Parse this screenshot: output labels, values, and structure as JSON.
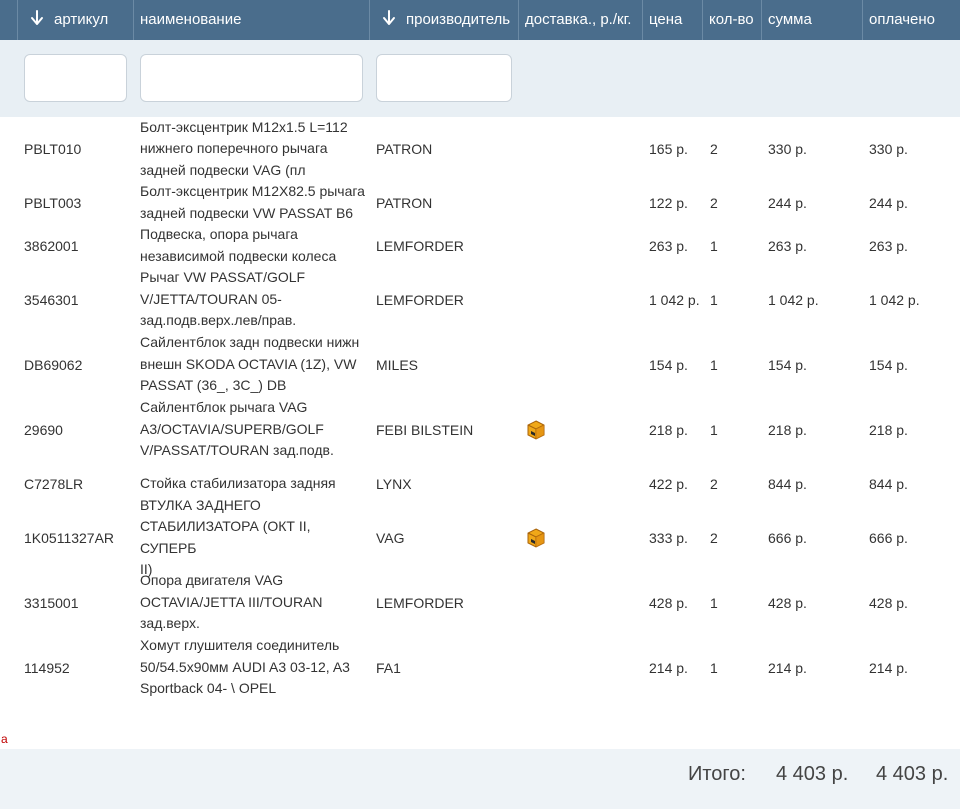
{
  "table": {
    "columns": {
      "article": "артикул",
      "name": "наименование",
      "maker": "производитель",
      "delivery": "доставка., р./кг.",
      "price": "цена",
      "qty": "кол-во",
      "sum": "сумма",
      "paid": "оплачено"
    },
    "filters": {
      "article": "",
      "name": "",
      "maker": ""
    },
    "rows": [
      {
        "article": "PBLT010",
        "name": [
          "Болт-эксцентрик М12x1.5 L=112",
          "нижнего поперечного рычага",
          "задней подвески VAG (пл"
        ],
        "maker": "PATRON",
        "delivery_icon": false,
        "price": "165 р.",
        "qty": "2",
        "sum": "330 р.",
        "paid": "330 р."
      },
      {
        "article": "PBLT003",
        "name": [
          "Болт-эксцентрик М12X82.5 рычага",
          "задней подвески VW PASSAT B6"
        ],
        "maker": "PATRON",
        "delivery_icon": false,
        "price": "122 р.",
        "qty": "2",
        "sum": "244 р.",
        "paid": "244 р."
      },
      {
        "article": "3862001",
        "name": [
          "Подвеска, опора рычага",
          "независимой подвески колеса"
        ],
        "maker": "LEMFORDER",
        "delivery_icon": false,
        "price": "263 р.",
        "qty": "1",
        "sum": "263 р.",
        "paid": "263 р."
      },
      {
        "article": "3546301",
        "name": [
          "Рычаг VW PASSAT/GOLF",
          "V/JETTA/TOURAN 05-",
          "зад.подв.верх.лев/прав."
        ],
        "maker": "LEMFORDER",
        "delivery_icon": false,
        "price": "1 042 р.",
        "qty": "1",
        "sum": "1 042 р.",
        "paid": "1 042 р."
      },
      {
        "article": "DB69062",
        "name": [
          "Сайлентблок задн подвески нижн",
          "внешн SKODA OCTAVIA (1Z), VW",
          "PASSAT (36_, 3C_) DB"
        ],
        "maker": "MILES",
        "delivery_icon": false,
        "price": "154 р.",
        "qty": "1",
        "sum": "154 р.",
        "paid": "154 р."
      },
      {
        "article": "29690",
        "name": [
          "Сайлентблок рычага VAG",
          "A3/OCTAVIA/SUPERB/GOLF",
          "V/PASSAT/TOURAN зад.подв."
        ],
        "maker": "FEBI BILSTEIN",
        "delivery_icon": true,
        "price": "218 р.",
        "qty": "1",
        "sum": "218 р.",
        "paid": "218 р."
      },
      {
        "article": "C7278LR",
        "name": [
          "Стойка стабилизатора задняя"
        ],
        "maker": "LYNX",
        "delivery_icon": false,
        "price": "422 р.",
        "qty": "2",
        "sum": "844 р.",
        "paid": "844 р."
      },
      {
        "article": "1K0511327AR",
        "name": [
          "ВТУЛКА ЗАДНЕГО",
          "СТАБИЛИЗАТОРА (ОКТ II, СУПЕРБ",
          "II)"
        ],
        "maker": "VAG",
        "delivery_icon": true,
        "price": "333 р.",
        "qty": "2",
        "sum": "666 р.",
        "paid": "666 р."
      },
      {
        "article": "3315001",
        "name": [
          "Опора двигателя VAG",
          "OCTAVIA/JETTA III/TOURAN",
          "зад.верх."
        ],
        "maker": "LEMFORDER",
        "delivery_icon": false,
        "price": "428 р.",
        "qty": "1",
        "sum": "428 р.",
        "paid": "428 р."
      },
      {
        "article": "114952",
        "name": [
          "Хомут глушителя соединитель",
          "50/54.5x90мм AUDI A3 03-12, A3",
          "Sportback 04- \\ OPEL"
        ],
        "maker": "FA1",
        "delivery_icon": false,
        "price": "214 р.",
        "qty": "1",
        "sum": "214 р.",
        "paid": "214 р."
      }
    ]
  },
  "marker_text": "a",
  "footer": {
    "total_label": "Итого:",
    "total_sum": "4 403 р.",
    "total_paid": "4 403 р."
  },
  "icons": {
    "sort": "arrow-down-icon",
    "delivery": "package-box-icon"
  },
  "colors": {
    "header_bg": "#4a6d8c",
    "filter_bg": "#e8eff4",
    "footer_bg": "#eef3f7",
    "marker": "#c00000"
  }
}
